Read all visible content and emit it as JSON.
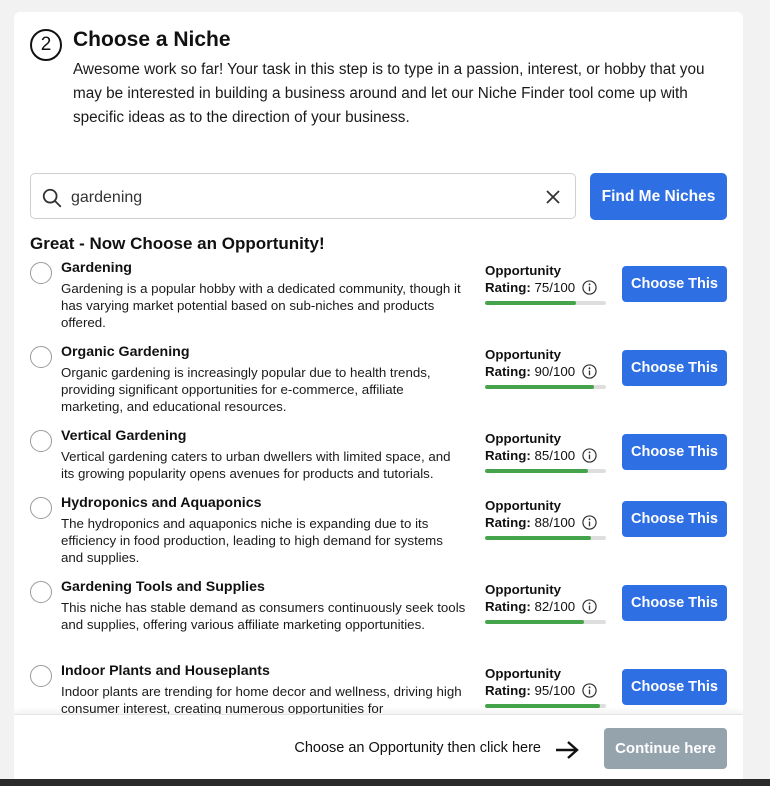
{
  "step": {
    "number": "2",
    "title": "Choose a Niche",
    "description": "Awesome work so far! Your task in this step is to type in a passion, interest, or hobby that you may be interested in building a business around and let our Niche Finder tool come up with specific ideas as to the direction of your business."
  },
  "search": {
    "value": "gardening",
    "find_button": "Find Me Niches"
  },
  "section_heading": "Great - Now Choose an Opportunity!",
  "opportunity_label": "Opportunity",
  "rating_label": "Rating:",
  "choose_button": "Choose This",
  "opportunities": [
    {
      "title": "Gardening",
      "description": "Gardening is a popular hobby with a dedicated community, though it has varying market potential based on sub-niches and products offered.",
      "rating": "75/100",
      "score": 75
    },
    {
      "title": "Organic Gardening",
      "description": "Organic gardening is increasingly popular due to health trends, providing significant opportunities for e-commerce, affiliate marketing, and educational resources.",
      "rating": "90/100",
      "score": 90
    },
    {
      "title": "Vertical Gardening",
      "description": "Vertical gardening caters to urban dwellers with limited space, and its growing popularity opens avenues for products and tutorials.",
      "rating": "85/100",
      "score": 85
    },
    {
      "title": "Hydroponics and Aquaponics",
      "description": "The hydroponics and aquaponics niche is expanding due to its efficiency in food production, leading to high demand for systems and supplies.",
      "rating": "88/100",
      "score": 88
    },
    {
      "title": "Gardening Tools and Supplies",
      "description": "This niche has stable demand as consumers continuously seek tools and supplies, offering various affiliate marketing opportunities.",
      "rating": "82/100",
      "score": 82
    },
    {
      "title": "Indoor Plants and Houseplants",
      "description": "Indoor plants are trending for home decor and wellness, driving high consumer interest, creating numerous opportunities for",
      "rating": "95/100",
      "score": 95
    }
  ],
  "footer": {
    "instruction": "Choose an Opportunity then click here",
    "continue_button": "Continue here"
  },
  "colors": {
    "primary": "#2f6fe4",
    "progress": "#45a34b",
    "disabled": "#95a3ad"
  },
  "icons": {
    "search": "search-icon",
    "clear": "close-icon",
    "info": "info-icon",
    "arrow": "arrow-right-icon"
  }
}
